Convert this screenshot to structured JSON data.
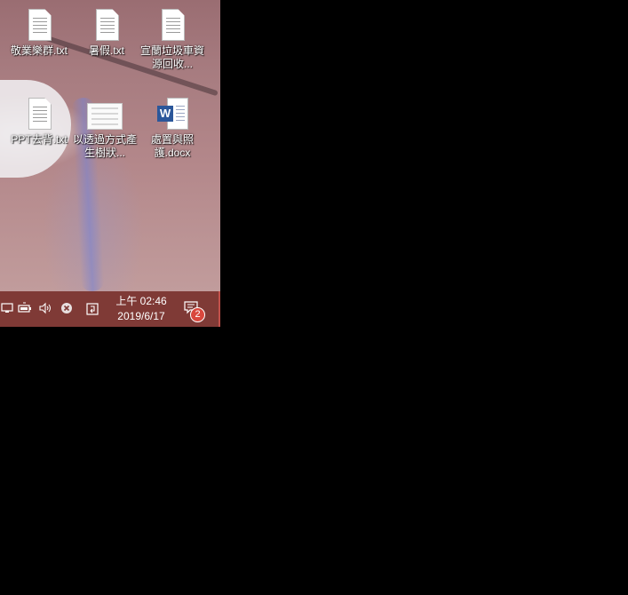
{
  "desktop": {
    "icons": [
      {
        "label": "敬業樂群.txt",
        "type": "txt"
      },
      {
        "label": "暑假.txt",
        "type": "txt"
      },
      {
        "label": "宣蘭垃圾車資源回收...",
        "type": "txt"
      },
      {
        "label": "PPT去背.txt",
        "type": "txt"
      },
      {
        "label": "以透過方式產生樹狀...",
        "type": "image"
      },
      {
        "label": "處置與照護.docx",
        "type": "docx"
      }
    ]
  },
  "taskbar": {
    "clock_time": "上午 02:46",
    "clock_date": "2019/6/17",
    "notification_count": "2",
    "word_badge_letter": "W",
    "colors": {
      "taskbar": "#7f3a36",
      "badge": "#d9473d",
      "accent_edge": "#c1504a"
    }
  }
}
